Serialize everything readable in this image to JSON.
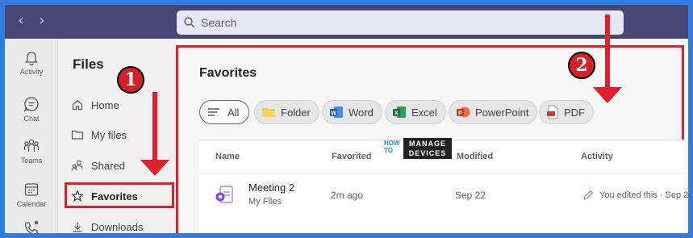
{
  "search": {
    "placeholder": "Search"
  },
  "rail": {
    "items": [
      {
        "label": "Activity",
        "icon": "bell-icon"
      },
      {
        "label": "Chat",
        "icon": "chat-icon"
      },
      {
        "label": "Teams",
        "icon": "teams-icon"
      },
      {
        "label": "Calendar",
        "icon": "calendar-icon"
      },
      {
        "label": "",
        "icon": "phone-icon"
      }
    ]
  },
  "files_pane": {
    "title": "Files",
    "items": [
      {
        "label": "Home",
        "icon": "home-icon"
      },
      {
        "label": "My files",
        "icon": "folder-icon"
      },
      {
        "label": "Shared",
        "icon": "shared-icon"
      },
      {
        "label": "Favorites",
        "icon": "star-icon"
      },
      {
        "label": "Downloads",
        "icon": "download-icon"
      }
    ]
  },
  "main": {
    "title": "Favorites",
    "filters": [
      {
        "label": "All",
        "selected": true
      },
      {
        "label": "Folder"
      },
      {
        "label": "Word"
      },
      {
        "label": "Excel"
      },
      {
        "label": "PowerPoint"
      },
      {
        "label": "PDF"
      }
    ],
    "table": {
      "columns": [
        "Name",
        "Favorited",
        "Modified",
        "Activity"
      ],
      "rows": [
        {
          "name": "Meeting 2",
          "location": "My Files",
          "favorited": "2m ago",
          "modified": "Sep 22",
          "activity": "You edited this · Sep 2"
        }
      ]
    }
  },
  "annotations": {
    "badge1": "1",
    "badge2": "2"
  },
  "watermark": {
    "line1": "HOW",
    "line2": "TO",
    "box1": "MANAGE",
    "box2": "DEVICES"
  },
  "colors": {
    "accent": "#5b5fc7",
    "topbar": "#464775",
    "annotation": "#e0202a",
    "background": "#2f7de1"
  }
}
